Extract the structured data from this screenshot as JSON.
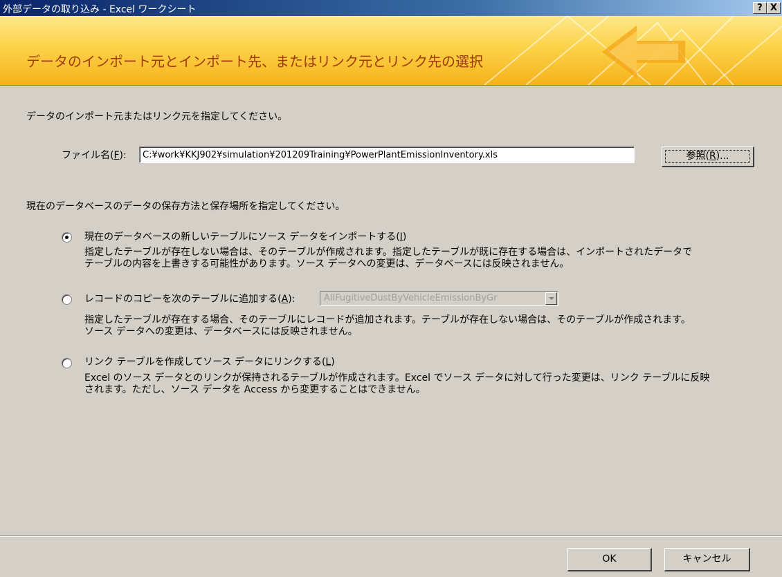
{
  "window": {
    "title": "外部データの取り込み - Excel ワークシート",
    "help_button": "?",
    "close_button": "X"
  },
  "banner": {
    "heading": "データのインポート元とインポート先、またはリンク元とリンク先の選択"
  },
  "source": {
    "instruction": "データのインポート元またはリンク元を指定してください。",
    "file_label": "ファイル名(",
    "file_label_key": "F",
    "file_label_end": "):",
    "file_path": "C:¥work¥KKJ902¥simulation¥201209Training¥PowerPlantEmissionInventory.xls",
    "browse_label": "参照(",
    "browse_key": "R",
    "browse_end": ")..."
  },
  "destination": {
    "instruction": "現在のデータベースのデータの保存方法と保存場所を指定してください。",
    "options": [
      {
        "label": "現在のデータベースの新しいテーブルにソース データをインポートする(",
        "key": "I",
        "label_end": ")",
        "selected": true,
        "description": [
          "指定したテーブルが存在しない場合は、そのテーブルが作成されます。指定したテーブルが既に存在する場合は、インポートされたデータで",
          "テーブルの内容を上書きする可能性があります。ソース データへの変更は、データベースには反映されません。"
        ]
      },
      {
        "label": "レコードのコピーを次のテーブルに追加する(",
        "key": "A",
        "label_end": "):",
        "selected": false,
        "table_value": "AllFugitiveDustByVehicleEmissionByGr",
        "description": [
          "指定したテーブルが存在する場合、そのテーブルにレコードが追加されます。テーブルが存在しない場合は、そのテーブルが作成されます。",
          "ソース データへの変更は、データベースには反映されません。"
        ]
      },
      {
        "label": "リンク テーブルを作成してソース データにリンクする(",
        "key": "L",
        "label_end": ")",
        "selected": false,
        "description": [
          "Excel のソース データとのリンクが保持されるテーブルが作成されます。Excel でソース データに対して行った変更は、リンク テーブルに反映",
          "されます。ただし、ソース データを Access から変更することはできません。"
        ]
      }
    ]
  },
  "footer": {
    "ok_label": "OK",
    "cancel_label": "キャンセル"
  },
  "colors": {
    "title_bar": "#0a246a",
    "banner": "#fcd34a",
    "banner_text": "#a23a08",
    "dialog": "#d4d0c8"
  }
}
